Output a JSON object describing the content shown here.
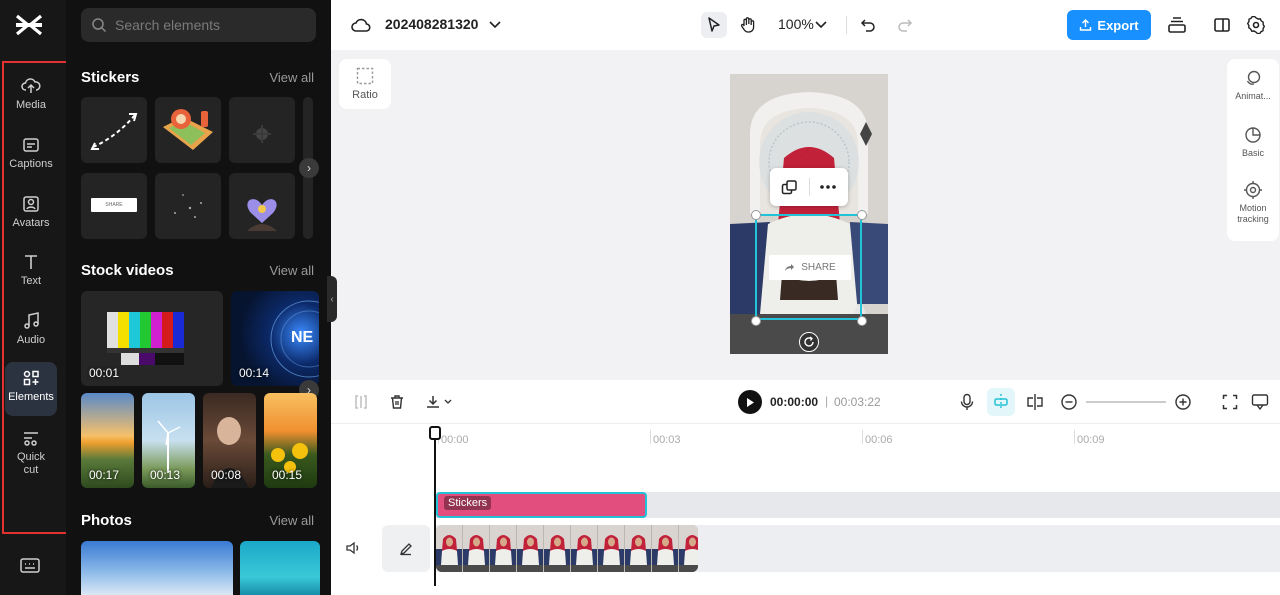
{
  "rail": {
    "items": [
      {
        "label": "Media",
        "icon": "cloud-upload-icon"
      },
      {
        "label": "Captions",
        "icon": "captions-icon"
      },
      {
        "label": "Avatars",
        "icon": "avatar-icon"
      },
      {
        "label": "Text",
        "icon": "text-icon"
      },
      {
        "label": "Audio",
        "icon": "music-note-icon"
      },
      {
        "label": "Elements",
        "icon": "elements-icon"
      },
      {
        "label": "Quick cut",
        "icon": "scissors-icon"
      }
    ],
    "active": "Elements"
  },
  "panel": {
    "search_placeholder": "Search elements",
    "stickers": {
      "title": "Stickers",
      "view_all": "View all",
      "share_label": "SHARE"
    },
    "stock_videos": {
      "title": "Stock videos",
      "view_all": "View all",
      "videos": [
        {
          "duration": "00:01"
        },
        {
          "duration": "00:14",
          "overlay": "NE"
        },
        {
          "duration": "00:17"
        },
        {
          "duration": "00:13"
        },
        {
          "duration": "00:08"
        },
        {
          "duration": "00:15"
        }
      ]
    },
    "photos": {
      "title": "Photos",
      "view_all": "View all"
    }
  },
  "topbar": {
    "project_name": "202408281320",
    "zoom": "100%",
    "export_label": "Export"
  },
  "canvas": {
    "ratio_label": "Ratio",
    "sticker_text": "SHARE",
    "right_props": [
      {
        "label": "Animat..."
      },
      {
        "label": "Basic"
      },
      {
        "label": "Motion tracking"
      }
    ]
  },
  "timeline": {
    "current_time": "00:00:00",
    "separator": "|",
    "total_time": "00:03:22",
    "ticks": [
      "00:00",
      "00:03",
      "00:06",
      "00:09"
    ],
    "sticker_clip_label": "Stickers"
  },
  "colors": {
    "accent": "#1890ff",
    "clip_pink": "#e24f7f",
    "selection_cyan": "#22c3d6",
    "rail_bg": "#171717",
    "panel_bg": "#111111"
  }
}
